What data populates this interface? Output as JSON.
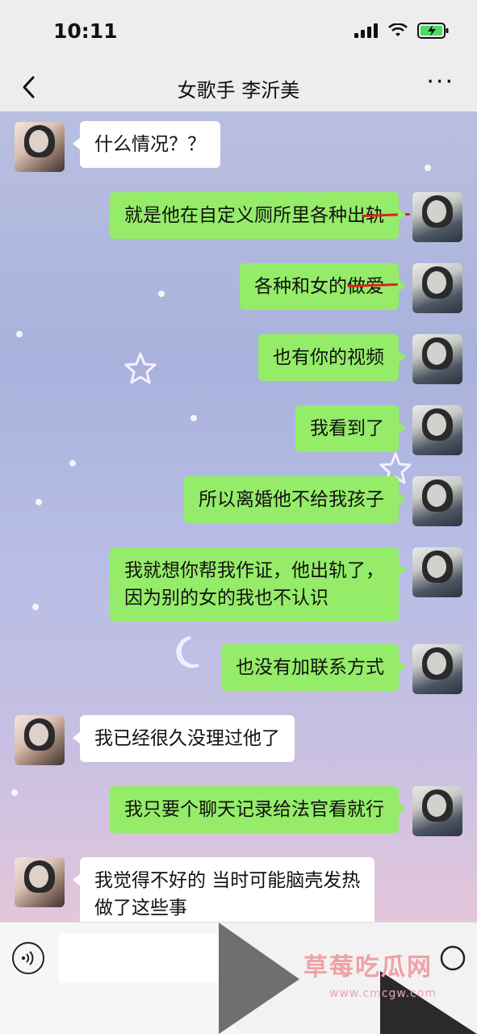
{
  "status": {
    "time": "10:11"
  },
  "header": {
    "title": "女歌手 李沂美",
    "back_icon": "chevron-left-icon",
    "more_icon": "more-dots-icon",
    "more_label": "···"
  },
  "messages": [
    {
      "side": "left",
      "text": "什么情况？？"
    },
    {
      "side": "right",
      "text": "就是他在自定义厕所里各种出轨"
    },
    {
      "side": "right",
      "text": "各种和女的做爱"
    },
    {
      "side": "right",
      "text": "也有你的视频"
    },
    {
      "side": "right",
      "text": "我看到了"
    },
    {
      "side": "right",
      "text": "所以离婚他不给我孩子"
    },
    {
      "side": "right",
      "line1": "我就想你帮我作证，他出轨了，",
      "line2": "因为别的女的我也不认识"
    },
    {
      "side": "right",
      "text": "也没有加联系方式"
    },
    {
      "side": "left",
      "text": "我已经很久没理过他了"
    },
    {
      "side": "right",
      "text": "我只要个聊天记录给法官看就行"
    },
    {
      "side": "left",
      "line1": "我觉得不好的 当时可能脑壳发热",
      "line2": "做了这些事"
    }
  ],
  "input": {
    "value": "",
    "placeholder": ""
  },
  "watermark": {
    "title": "草莓吃瓜网",
    "url": "www.cmcgw.com"
  },
  "colors": {
    "bubble_right": "#95ec69",
    "bubble_left": "#ffffff",
    "strike": "#e02020"
  }
}
